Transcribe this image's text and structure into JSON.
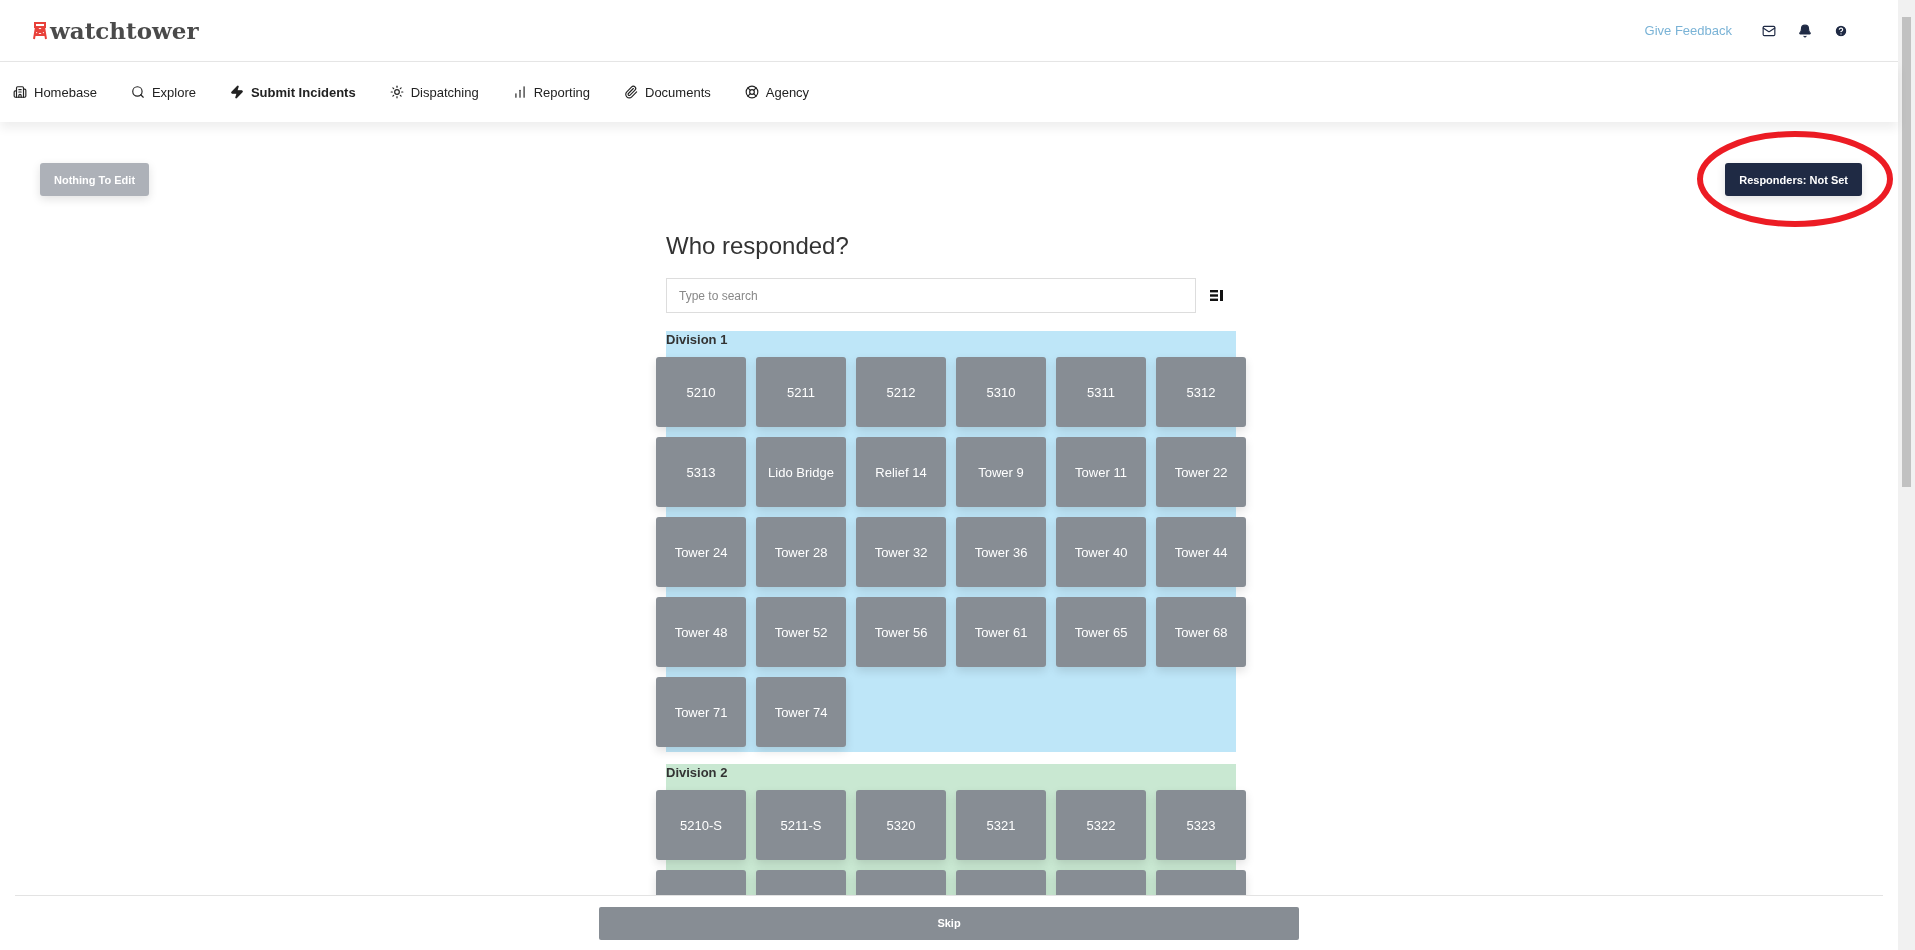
{
  "header": {
    "logo": "watchtower",
    "feedback_link": "Give Feedback"
  },
  "nav": [
    {
      "label": "Homebase",
      "kind": "building",
      "selected": false
    },
    {
      "label": "Explore",
      "kind": "search",
      "selected": false
    },
    {
      "label": "Submit Incidents",
      "kind": "bolt",
      "selected": true
    },
    {
      "label": "Dispatching",
      "kind": "burst",
      "selected": false
    },
    {
      "label": "Reporting",
      "kind": "chart",
      "selected": false
    },
    {
      "label": "Documents",
      "kind": "clip",
      "selected": false
    },
    {
      "label": "Agency",
      "kind": "lifebuoy",
      "selected": false
    }
  ],
  "edit_button": {
    "label": "Nothing To Edit",
    "disabled": true
  },
  "responders_button": {
    "label": "Responders: Not Set",
    "highlighted": true
  },
  "title": "Who responded?",
  "search": {
    "placeholder": "Type to search"
  },
  "divisions": [
    {
      "name": "Division 1",
      "color": "#bee6f8",
      "units": [
        {
          "kind": "unit",
          "label": "5210"
        },
        {
          "kind": "unit",
          "label": "5211"
        },
        {
          "kind": "unit",
          "label": "5212"
        },
        {
          "kind": "unit",
          "label": "5310"
        },
        {
          "kind": "unit",
          "label": "5311"
        },
        {
          "kind": "unit",
          "label": "5312"
        },
        {
          "kind": "unit",
          "label": "5313"
        },
        {
          "kind": "unit",
          "label": "Lido Bridge"
        },
        {
          "kind": "unit",
          "label": "Relief 14"
        },
        {
          "kind": "unit",
          "label": "Tower 9"
        },
        {
          "kind": "unit",
          "label": "Tower 11"
        },
        {
          "kind": "unit",
          "label": "Tower 22"
        },
        {
          "kind": "unit",
          "label": "Tower 24"
        },
        {
          "kind": "unit",
          "label": "Tower 28"
        },
        {
          "kind": "unit",
          "label": "Tower 32"
        },
        {
          "kind": "unit",
          "label": "Tower 36"
        },
        {
          "kind": "unit",
          "label": "Tower 40"
        },
        {
          "kind": "unit",
          "label": "Tower 44"
        },
        {
          "kind": "unit",
          "label": "Tower 48"
        },
        {
          "kind": "unit",
          "label": "Tower 52"
        },
        {
          "kind": "unit",
          "label": "Tower 56"
        },
        {
          "kind": "unit",
          "label": "Tower 61"
        },
        {
          "kind": "unit",
          "label": "Tower 65"
        },
        {
          "kind": "unit",
          "label": "Tower 68"
        },
        {
          "kind": "unit",
          "label": "Tower 71"
        },
        {
          "kind": "unit",
          "label": "Tower 74"
        }
      ]
    },
    {
      "name": "Division 2",
      "color": "#c9e8d2",
      "units": [
        {
          "kind": "unit",
          "label": "5210-S"
        },
        {
          "kind": "unit",
          "label": "5211-S"
        },
        {
          "kind": "unit",
          "label": "5320"
        },
        {
          "kind": "unit",
          "label": "5321"
        },
        {
          "kind": "unit",
          "label": "5322"
        },
        {
          "kind": "unit",
          "label": "5323"
        },
        {
          "kind": "cut"
        },
        {
          "kind": "cut"
        },
        {
          "kind": "cut"
        },
        {
          "kind": "cut"
        },
        {
          "kind": "cut"
        },
        {
          "kind": "cut"
        }
      ]
    }
  ],
  "footer": {
    "skip_button": "Skip"
  }
}
